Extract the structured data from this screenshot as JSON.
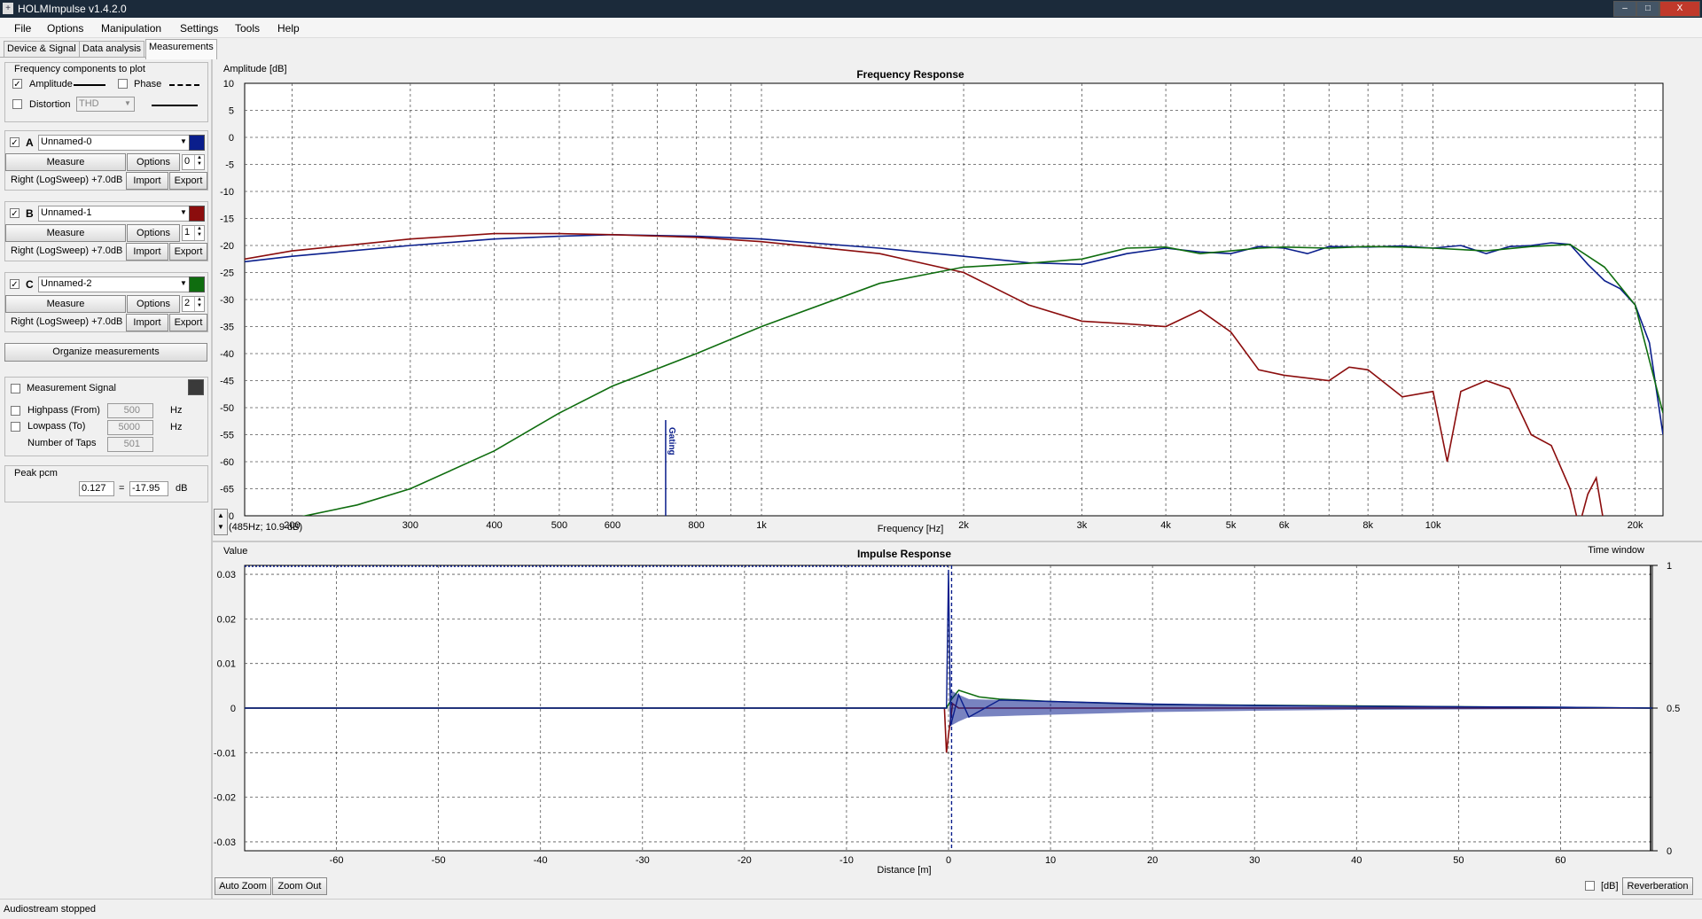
{
  "window": {
    "title": "HOLMImpulse  v1.4.2.0",
    "icon_glyph": "+",
    "min": "–",
    "max": "□",
    "close": "X"
  },
  "menu": [
    "File",
    "Options",
    "Manipulation",
    "Settings",
    "Tools",
    "Help"
  ],
  "tabs": [
    "Device & Signal",
    "Data analysis",
    "Measurements"
  ],
  "freq_components": {
    "title": "Frequency components to plot",
    "amplitude": {
      "label": "Amplitude",
      "checked": true
    },
    "phase": {
      "label": "Phase",
      "checked": false
    },
    "distortion": {
      "label": "Distortion",
      "checked": false,
      "select": "THD"
    }
  },
  "measurements": [
    {
      "letter": "A",
      "name": "Unnamed-0",
      "color": "#0a1e8c",
      "checked": true,
      "measure": "Measure",
      "options": "Options",
      "index": "0",
      "desc": "Right (LogSweep) +7.0dB",
      "import": "Import",
      "export": "Export"
    },
    {
      "letter": "B",
      "name": "Unnamed-1",
      "color": "#8b0d0d",
      "checked": true,
      "measure": "Measure",
      "options": "Options",
      "index": "1",
      "desc": "Right (LogSweep) +7.0dB",
      "import": "Import",
      "export": "Export"
    },
    {
      "letter": "C",
      "name": "Unnamed-2",
      "color": "#0f6d0f",
      "checked": true,
      "measure": "Measure",
      "options": "Options",
      "index": "2",
      "desc": "Right (LogSweep) +7.0dB",
      "import": "Import",
      "export": "Export"
    }
  ],
  "organize_button": "Organize measurements",
  "measurement_signal": {
    "label": "Measurement Signal",
    "checked": false,
    "color": "#3a3a3a"
  },
  "filters": {
    "highpass": {
      "label": "Highpass (From)",
      "value": "500",
      "unit": "Hz",
      "checked": false
    },
    "lowpass": {
      "label": "Lowpass (To)",
      "value": "5000",
      "unit": "Hz",
      "checked": false
    },
    "taps": {
      "label": "Number of Taps",
      "value": "501"
    }
  },
  "peak": {
    "label": "Peak pcm",
    "value": "0.127",
    "eq": "=",
    "db": "-17.95",
    "unit": "dB"
  },
  "freq_chart": {
    "title": "Frequency Response",
    "ylabel": "Amplitude [dB]",
    "xlabel": "Frequency [Hz]",
    "gating_label": "Gating",
    "cursor_readout": "(485Hz; 10.9 dB)",
    "yticks": [
      "10",
      "5",
      "0",
      "-5",
      "-10",
      "-15",
      "-20",
      "-25",
      "-30",
      "-35",
      "-40",
      "-45",
      "-50",
      "-55",
      "-60",
      "-65",
      "-70"
    ],
    "xticks": [
      "200",
      "300",
      "400",
      "500",
      "600",
      "800",
      "1k",
      "2k",
      "3k",
      "4k",
      "5k",
      "6k",
      "8k",
      "10k",
      "20k"
    ]
  },
  "impulse_chart": {
    "title": "Impulse Response",
    "ylabel": "Value",
    "xlabel": "Distance [m]",
    "right_label": "Time window",
    "yticks": [
      "0.03",
      "0.02",
      "0.01",
      "0",
      "-0.01",
      "-0.02",
      "-0.03"
    ],
    "xticks": [
      "-60",
      "-50",
      "-40",
      "-30",
      "-20",
      "-10",
      "0",
      "10",
      "20",
      "30",
      "40",
      "50",
      "60"
    ],
    "right_ticks": [
      "1",
      "0.5",
      "0"
    ]
  },
  "bottom": {
    "auto_zoom": "Auto Zoom",
    "zoom_out": "Zoom Out",
    "db_label": "[dB]",
    "reverb": "Reverberation"
  },
  "status": "Audiostream stopped",
  "chart_data": [
    {
      "type": "line",
      "title": "Frequency Response",
      "xlabel": "Frequency [Hz]",
      "ylabel": "Amplitude [dB]",
      "xscale": "log",
      "xlim": [
        170,
        22000
      ],
      "ylim": [
        -70,
        10
      ],
      "grid": true,
      "series": [
        {
          "name": "Unnamed-0",
          "color": "#0a1e8c",
          "x": [
            170,
            200,
            300,
            400,
            500,
            600,
            800,
            1000,
            1500,
            2000,
            2500,
            3000,
            3500,
            4000,
            4500,
            5000,
            5500,
            6000,
            6500,
            7000,
            8000,
            9000,
            10000,
            11000,
            12000,
            13000,
            14000,
            15000,
            16000,
            17000,
            18000,
            19000,
            20000,
            21000,
            22000
          ],
          "y": [
            -23,
            -22,
            -20,
            -18.8,
            -18.3,
            -18,
            -18.3,
            -18.8,
            -20.5,
            -22,
            -23.2,
            -23.5,
            -21.5,
            -20.5,
            -21.2,
            -21.5,
            -20.2,
            -20.5,
            -21.5,
            -20.2,
            -20.3,
            -20.1,
            -20.5,
            -20,
            -21.5,
            -20.2,
            -20,
            -19.5,
            -19.8,
            -23.5,
            -26.5,
            -28,
            -31,
            -38,
            -55
          ]
        },
        {
          "name": "Unnamed-1",
          "color": "#8b0d0d",
          "x": [
            170,
            200,
            300,
            400,
            500,
            600,
            800,
            1000,
            1500,
            2000,
            2500,
            3000,
            3500,
            4000,
            4500,
            5000,
            5500,
            6000,
            7000,
            7500,
            8000,
            9000,
            10000,
            10500,
            11000,
            12000,
            13000,
            14000,
            15000,
            16000,
            16500,
            17000,
            17500,
            18000
          ],
          "y": [
            -22.5,
            -21,
            -18.8,
            -17.8,
            -17.8,
            -18,
            -18.5,
            -19.3,
            -21.5,
            -25,
            -31,
            -34,
            -34.5,
            -35,
            -32,
            -36,
            -43,
            -44,
            -45,
            -42.5,
            -43,
            -48,
            -47,
            -60,
            -47,
            -45,
            -46.5,
            -55,
            -57,
            -65,
            -72,
            -66,
            -63,
            -72
          ]
        },
        {
          "name": "Unnamed-2",
          "color": "#0f6d0f",
          "x": [
            170,
            200,
            250,
            300,
            400,
            500,
            600,
            800,
            1000,
            1500,
            2000,
            2500,
            3000,
            3500,
            4000,
            4500,
            5000,
            5500,
            6000,
            7000,
            8000,
            9000,
            10000,
            12000,
            14000,
            16000,
            18000,
            20000,
            22000
          ],
          "y": [
            -71,
            -70.5,
            -68,
            -65,
            -58,
            -51,
            -46,
            -40,
            -35,
            -27,
            -24,
            -23.3,
            -22.5,
            -20.5,
            -20.3,
            -21.5,
            -21,
            -20.5,
            -20.3,
            -20.5,
            -20.2,
            -20.3,
            -20.5,
            -21,
            -20.2,
            -19.8,
            -24,
            -31,
            -51
          ]
        }
      ]
    },
    {
      "type": "line",
      "title": "Impulse Response",
      "xlabel": "Distance [m]",
      "ylabel": "Value",
      "xlim": [
        -69,
        69
      ],
      "ylim": [
        -0.032,
        0.032
      ],
      "grid": true,
      "series": [
        {
          "name": "Unnamed-0",
          "color": "#0a1e8c",
          "x": [
            -69,
            -0.2,
            0,
            0.2,
            1,
            2,
            5,
            10,
            15,
            20,
            30,
            40,
            50,
            60,
            69
          ],
          "y": [
            0,
            0,
            0.031,
            -0.004,
            0.003,
            -0.002,
            0.0018,
            0.0015,
            0.0012,
            0.0009,
            0.0006,
            0.0004,
            0.0003,
            0.0002,
            0
          ]
        },
        {
          "name": "Unnamed-1",
          "color": "#8b0d0d",
          "x": [
            -69,
            -0.4,
            -0.2,
            0,
            0.4,
            1,
            69
          ],
          "y": [
            0,
            0,
            -0.01,
            -0.006,
            0.001,
            0,
            0
          ]
        },
        {
          "name": "Unnamed-2",
          "color": "#0f6d0f",
          "x": [
            -69,
            -0.2,
            0.3,
            1,
            3,
            5,
            10,
            20,
            69
          ],
          "y": [
            0,
            0,
            0.002,
            0.004,
            0.0025,
            0.002,
            0.0015,
            0.0008,
            0
          ]
        }
      ],
      "time_window": {
        "ylim": [
          0,
          1
        ],
        "start": 0,
        "end": 0.5
      }
    }
  ]
}
